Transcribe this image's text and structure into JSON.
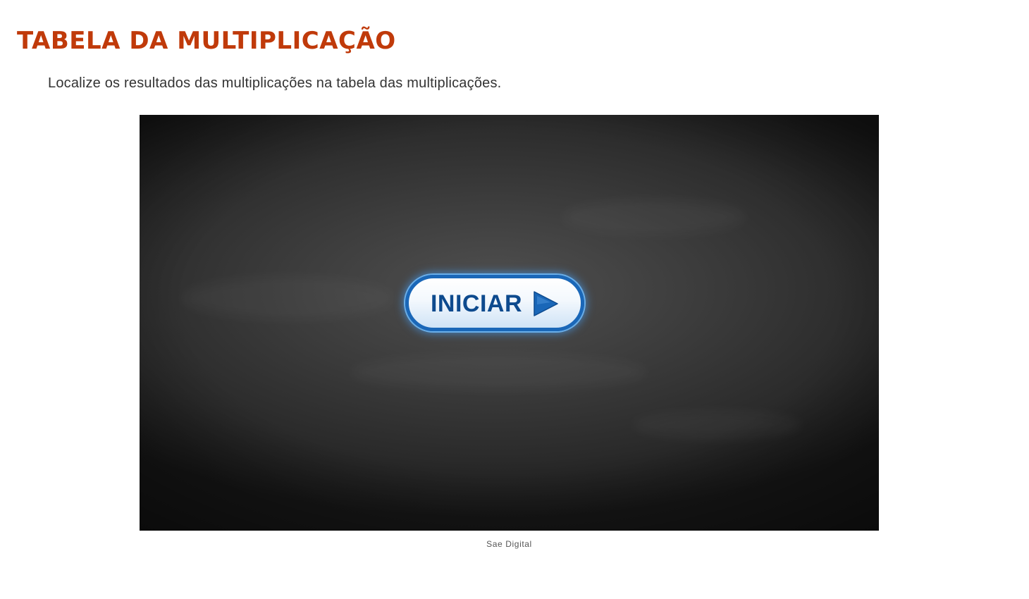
{
  "header": {
    "title": "TABELA DA MULTIPLICAÇÃO",
    "instruction": "Localize os resultados das multiplicações na tabela das multiplicações."
  },
  "activity": {
    "start_button_label": "INICIAR",
    "start_button_icon": "play-arrow-icon",
    "caption": "Sae Digital"
  },
  "colors": {
    "title": "#c03a0a",
    "button_border": "#1a67b8",
    "button_text": "#0d4a8e",
    "stage_background": "#3c3c3c"
  }
}
